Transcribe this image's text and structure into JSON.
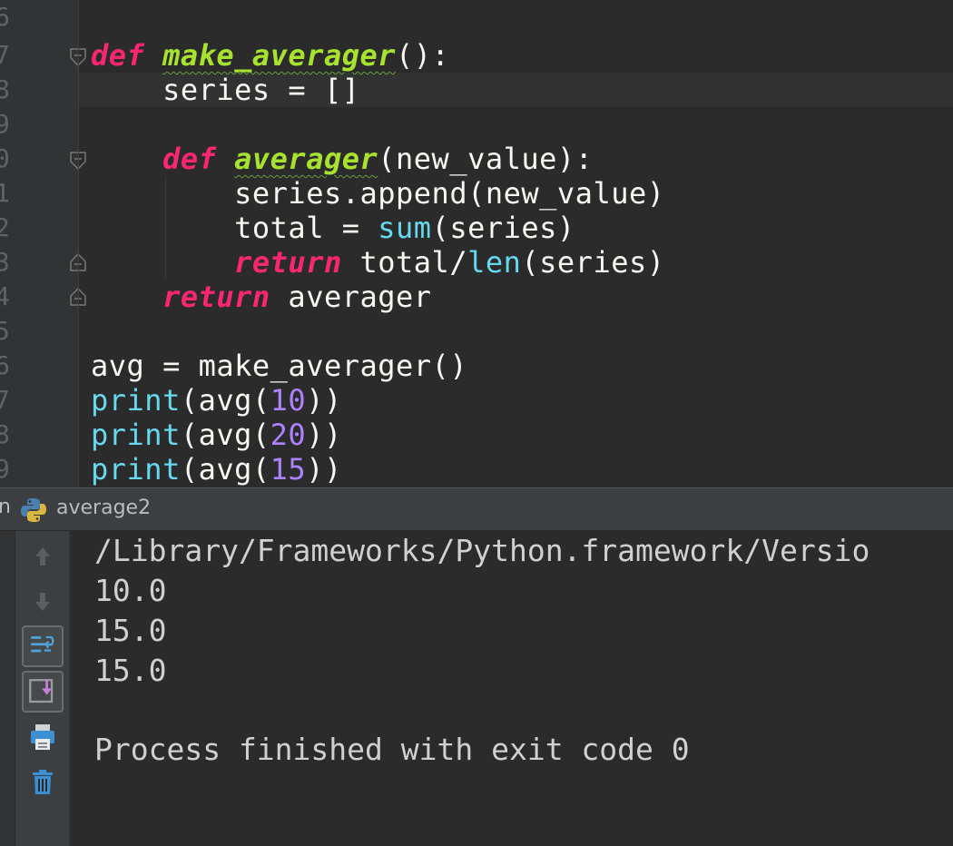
{
  "editor": {
    "line_numbers": [
      "6",
      "7",
      "8",
      "9",
      "0",
      "1",
      "2",
      "3",
      "4",
      "5",
      "6",
      "7",
      "8",
      "9"
    ],
    "colors": {
      "keyword": "#f92672",
      "function": "#a6e22e",
      "builtin": "#66d9ef",
      "number": "#ae81ff",
      "text": "#f8f8f2"
    },
    "code": {
      "l1_kw": "def",
      "l1_name": "make_averager",
      "l1_rest": "():",
      "l2": "    series = []",
      "l4_indent": "    ",
      "l4_kw": "def",
      "l4_name": "averager",
      "l4_rest": "(new_value):",
      "l5": "        series.append(new_value)",
      "l6_pre": "        total = ",
      "l6_builtin": "sum",
      "l6_post": "(series)",
      "l7_indent": "        ",
      "l7_kw": "return",
      "l7_mid": " total/",
      "l7_builtin": "len",
      "l7_post": "(series)",
      "l8_indent": "    ",
      "l8_kw": "return",
      "l8_rest": " averager",
      "l10": "avg = make_averager()",
      "l11_builtin": "print",
      "l11_pre": "(avg(",
      "l11_num": "10",
      "l11_post": "))",
      "l12_builtin": "print",
      "l12_pre": "(avg(",
      "l12_num": "20",
      "l12_post": "))",
      "l13_builtin": "print",
      "l13_pre": "(avg(",
      "l13_num": "15",
      "l13_post": "))"
    }
  },
  "run_panel": {
    "prefix": "n",
    "tab_label": "average2",
    "tool_icons": [
      "up-arrow-icon",
      "down-arrow-icon",
      "soft-wrap-icon",
      "scroll-to-end-icon",
      "print-icon",
      "trash-icon"
    ]
  },
  "console": {
    "lines": [
      "/Library/Frameworks/Python.framework/Versio",
      "10.0",
      "15.0",
      "15.0",
      "",
      "Process finished with exit code 0"
    ]
  }
}
